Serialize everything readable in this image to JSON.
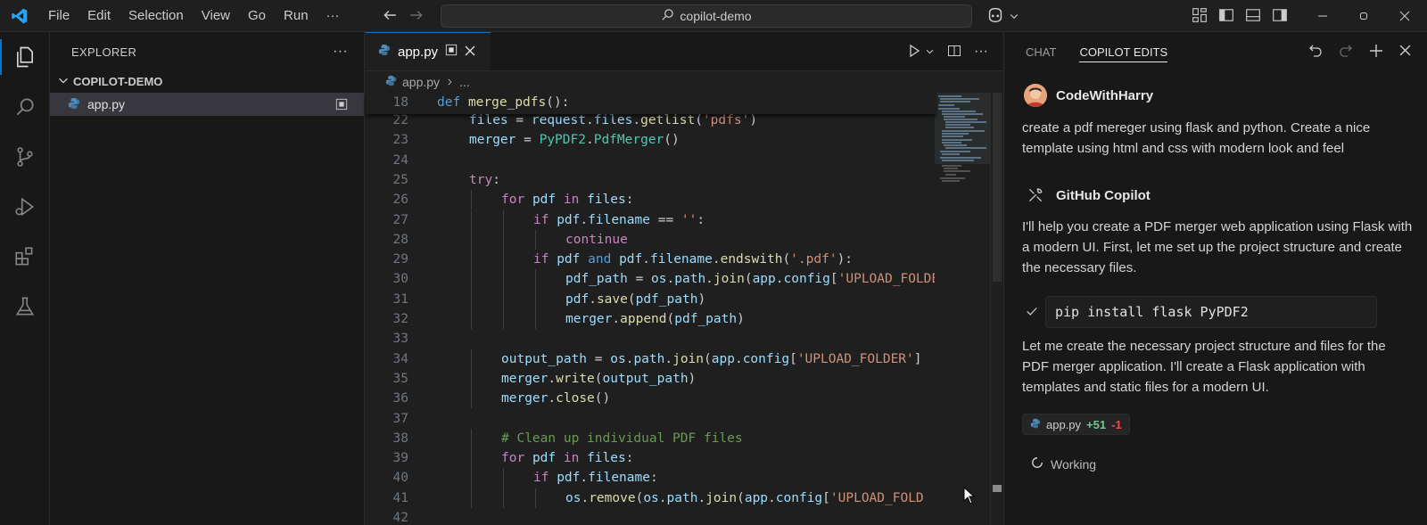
{
  "menu": [
    "File",
    "Edit",
    "Selection",
    "View",
    "Go",
    "Run",
    "···"
  ],
  "search": {
    "text": "copilot-demo"
  },
  "explorer": {
    "title": "EXPLORER",
    "more": "···",
    "folder": "COPILOT-DEMO",
    "files": [
      {
        "name": "app.py"
      }
    ]
  },
  "editor": {
    "tab_label": "app.py",
    "breadcrumb_file": "app.py",
    "breadcrumb_more": "...",
    "sticky": {
      "num": "18",
      "kw": "def",
      "name": "merge_pdfs",
      "rest": "():"
    },
    "lines": [
      {
        "num": "22",
        "indent": 1,
        "tokens": [
          {
            "c": "var",
            "t": "files"
          },
          {
            "c": "",
            "t": " = "
          },
          {
            "c": "var",
            "t": "request"
          },
          {
            "c": "",
            "t": "."
          },
          {
            "c": "var",
            "t": "files"
          },
          {
            "c": "",
            "t": "."
          },
          {
            "c": "fn",
            "t": "getlist"
          },
          {
            "c": "",
            "t": "("
          },
          {
            "c": "str",
            "t": "'pdfs'"
          },
          {
            "c": "",
            "t": ")"
          }
        ]
      },
      {
        "num": "23",
        "indent": 1,
        "tokens": [
          {
            "c": "var",
            "t": "merger"
          },
          {
            "c": "",
            "t": " = "
          },
          {
            "c": "cls",
            "t": "PyPDF2"
          },
          {
            "c": "",
            "t": "."
          },
          {
            "c": "cls",
            "t": "PdfMerger"
          },
          {
            "c": "",
            "t": "()"
          }
        ]
      },
      {
        "num": "24",
        "indent": 0,
        "tokens": []
      },
      {
        "num": "25",
        "indent": 1,
        "tokens": [
          {
            "c": "ctl",
            "t": "try"
          },
          {
            "c": "",
            "t": ":"
          }
        ]
      },
      {
        "num": "26",
        "indent": 2,
        "tokens": [
          {
            "c": "ctl",
            "t": "for"
          },
          {
            "c": "",
            "t": " "
          },
          {
            "c": "var",
            "t": "pdf"
          },
          {
            "c": "",
            "t": " "
          },
          {
            "c": "ctl",
            "t": "in"
          },
          {
            "c": "",
            "t": " "
          },
          {
            "c": "var",
            "t": "files"
          },
          {
            "c": "",
            "t": ":"
          }
        ]
      },
      {
        "num": "27",
        "indent": 3,
        "tokens": [
          {
            "c": "ctl",
            "t": "if"
          },
          {
            "c": "",
            "t": " "
          },
          {
            "c": "var",
            "t": "pdf"
          },
          {
            "c": "",
            "t": "."
          },
          {
            "c": "var",
            "t": "filename"
          },
          {
            "c": "",
            "t": " == "
          },
          {
            "c": "str",
            "t": "''"
          },
          {
            "c": "",
            "t": ":"
          }
        ]
      },
      {
        "num": "28",
        "indent": 4,
        "tokens": [
          {
            "c": "ctl",
            "t": "continue"
          }
        ]
      },
      {
        "num": "29",
        "indent": 3,
        "tokens": [
          {
            "c": "ctl",
            "t": "if"
          },
          {
            "c": "",
            "t": " "
          },
          {
            "c": "var",
            "t": "pdf"
          },
          {
            "c": "",
            "t": " "
          },
          {
            "c": "kw",
            "t": "and"
          },
          {
            "c": "",
            "t": " "
          },
          {
            "c": "var",
            "t": "pdf"
          },
          {
            "c": "",
            "t": "."
          },
          {
            "c": "var",
            "t": "filename"
          },
          {
            "c": "",
            "t": "."
          },
          {
            "c": "fn",
            "t": "endswith"
          },
          {
            "c": "",
            "t": "("
          },
          {
            "c": "str",
            "t": "'.pdf'"
          },
          {
            "c": "",
            "t": "):"
          }
        ]
      },
      {
        "num": "30",
        "indent": 4,
        "tokens": [
          {
            "c": "var",
            "t": "pdf_path"
          },
          {
            "c": "",
            "t": " = "
          },
          {
            "c": "var",
            "t": "os"
          },
          {
            "c": "",
            "t": "."
          },
          {
            "c": "var",
            "t": "path"
          },
          {
            "c": "",
            "t": "."
          },
          {
            "c": "fn",
            "t": "join"
          },
          {
            "c": "",
            "t": "("
          },
          {
            "c": "var",
            "t": "app"
          },
          {
            "c": "",
            "t": "."
          },
          {
            "c": "var",
            "t": "config"
          },
          {
            "c": "",
            "t": "["
          },
          {
            "c": "str",
            "t": "'UPLOAD_FOLDER'"
          }
        ]
      },
      {
        "num": "31",
        "indent": 4,
        "tokens": [
          {
            "c": "var",
            "t": "pdf"
          },
          {
            "c": "",
            "t": "."
          },
          {
            "c": "fn",
            "t": "save"
          },
          {
            "c": "",
            "t": "("
          },
          {
            "c": "var",
            "t": "pdf_path"
          },
          {
            "c": "",
            "t": ")"
          }
        ]
      },
      {
        "num": "32",
        "indent": 4,
        "tokens": [
          {
            "c": "var",
            "t": "merger"
          },
          {
            "c": "",
            "t": "."
          },
          {
            "c": "fn",
            "t": "append"
          },
          {
            "c": "",
            "t": "("
          },
          {
            "c": "var",
            "t": "pdf_path"
          },
          {
            "c": "",
            "t": ")"
          }
        ]
      },
      {
        "num": "33",
        "indent": 0,
        "tokens": []
      },
      {
        "num": "34",
        "indent": 2,
        "tokens": [
          {
            "c": "var",
            "t": "output_path"
          },
          {
            "c": "",
            "t": " = "
          },
          {
            "c": "var",
            "t": "os"
          },
          {
            "c": "",
            "t": "."
          },
          {
            "c": "var",
            "t": "path"
          },
          {
            "c": "",
            "t": "."
          },
          {
            "c": "fn",
            "t": "join"
          },
          {
            "c": "",
            "t": "("
          },
          {
            "c": "var",
            "t": "app"
          },
          {
            "c": "",
            "t": "."
          },
          {
            "c": "var",
            "t": "config"
          },
          {
            "c": "",
            "t": "["
          },
          {
            "c": "str",
            "t": "'UPLOAD_FOLDER'"
          },
          {
            "c": "",
            "t": "]"
          }
        ]
      },
      {
        "num": "35",
        "indent": 2,
        "tokens": [
          {
            "c": "var",
            "t": "merger"
          },
          {
            "c": "",
            "t": "."
          },
          {
            "c": "fn",
            "t": "write"
          },
          {
            "c": "",
            "t": "("
          },
          {
            "c": "var",
            "t": "output_path"
          },
          {
            "c": "",
            "t": ")"
          }
        ]
      },
      {
        "num": "36",
        "indent": 2,
        "tokens": [
          {
            "c": "var",
            "t": "merger"
          },
          {
            "c": "",
            "t": "."
          },
          {
            "c": "fn",
            "t": "close"
          },
          {
            "c": "",
            "t": "()"
          }
        ]
      },
      {
        "num": "37",
        "indent": 0,
        "tokens": []
      },
      {
        "num": "38",
        "indent": 2,
        "tokens": [
          {
            "c": "cm",
            "t": "# Clean up individual PDF files"
          }
        ]
      },
      {
        "num": "39",
        "indent": 2,
        "tokens": [
          {
            "c": "ctl",
            "t": "for"
          },
          {
            "c": "",
            "t": " "
          },
          {
            "c": "var",
            "t": "pdf"
          },
          {
            "c": "",
            "t": " "
          },
          {
            "c": "ctl",
            "t": "in"
          },
          {
            "c": "",
            "t": " "
          },
          {
            "c": "var",
            "t": "files"
          },
          {
            "c": "",
            "t": ":"
          }
        ]
      },
      {
        "num": "40",
        "indent": 3,
        "tokens": [
          {
            "c": "ctl",
            "t": "if"
          },
          {
            "c": "",
            "t": " "
          },
          {
            "c": "var",
            "t": "pdf"
          },
          {
            "c": "",
            "t": "."
          },
          {
            "c": "var",
            "t": "filename"
          },
          {
            "c": "",
            "t": ":"
          }
        ]
      },
      {
        "num": "41",
        "indent": 4,
        "tokens": [
          {
            "c": "var",
            "t": "os"
          },
          {
            "c": "",
            "t": "."
          },
          {
            "c": "fn",
            "t": "remove"
          },
          {
            "c": "",
            "t": "("
          },
          {
            "c": "var",
            "t": "os"
          },
          {
            "c": "",
            "t": "."
          },
          {
            "c": "var",
            "t": "path"
          },
          {
            "c": "",
            "t": "."
          },
          {
            "c": "fn",
            "t": "join"
          },
          {
            "c": "",
            "t": "("
          },
          {
            "c": "var",
            "t": "app"
          },
          {
            "c": "",
            "t": "."
          },
          {
            "c": "var",
            "t": "config"
          },
          {
            "c": "",
            "t": "["
          },
          {
            "c": "str",
            "t": "'UPLOAD_FOLD"
          }
        ]
      },
      {
        "num": "42",
        "indent": 0,
        "tokens": []
      }
    ]
  },
  "chat": {
    "tabs": [
      "CHAT",
      "COPILOT EDITS"
    ],
    "user_name": "CodeWithHarry",
    "user_message": "create a pdf mereger using flask and python. Create a nice template using html and css with modern look and feel",
    "bot_name": "GitHub Copilot",
    "bot_message_1": "I'll help you create a PDF merger web application using Flask with a modern UI. First, let me set up the project structure and create the necessary files.",
    "command": "pip install flask PyPDF2",
    "bot_message_2": "Let me create the necessary project structure and files for the PDF merger application. I'll create a Flask application with templates and static files for a modern UI.",
    "file_chip": {
      "name": "app.py",
      "added": "+51",
      "removed": "-1"
    },
    "status": "Working"
  },
  "colors": {
    "accent": "#0078d4",
    "keyword": "#569cd6",
    "control": "#c586c0",
    "function": "#dcdcaa",
    "string": "#ce9178",
    "comment": "#6a9955",
    "variable": "#9cdcfe",
    "class": "#4ec9b0"
  }
}
